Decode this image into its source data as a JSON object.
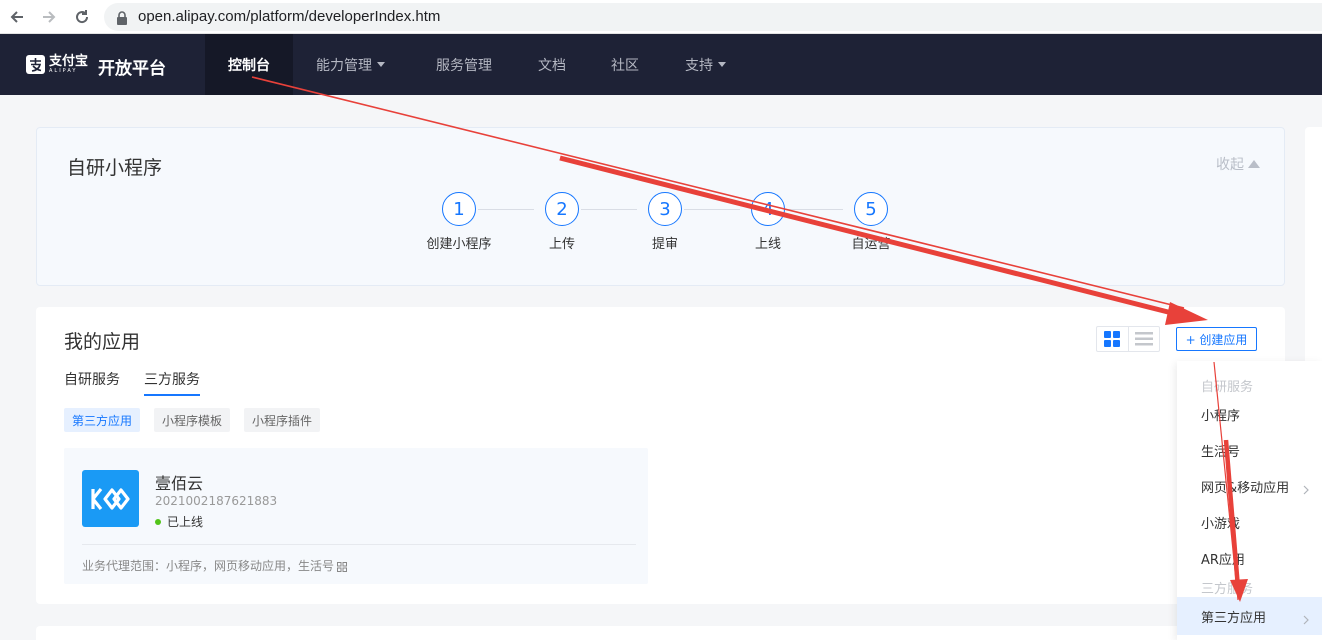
{
  "browser": {
    "url": "open.alipay.com/platform/developerIndex.htm"
  },
  "brand": {
    "logo_cn": "支付宝",
    "logo_en": "ALIPAY",
    "platform": "开放平台"
  },
  "topnav": {
    "items": [
      {
        "label": "控制台",
        "active": true
      },
      {
        "label": "能力管理",
        "caret": true
      },
      {
        "label": "服务管理"
      },
      {
        "label": "文档"
      },
      {
        "label": "社区"
      },
      {
        "label": "支持",
        "caret": true
      }
    ]
  },
  "miniprogram": {
    "title": "自研小程序",
    "collapse_label": "收起",
    "steps": [
      {
        "num": "1",
        "label": "创建小程序"
      },
      {
        "num": "2",
        "label": "上传"
      },
      {
        "num": "3",
        "label": "提审"
      },
      {
        "num": "4",
        "label": "上线"
      },
      {
        "num": "5",
        "label": "自运营"
      }
    ]
  },
  "apps": {
    "title": "我的应用",
    "create_label": "+ 创建应用",
    "tabs": [
      {
        "label": "自研服务"
      },
      {
        "label": "三方服务",
        "active": true
      }
    ],
    "chips": [
      {
        "label": "第三方应用",
        "active": true
      },
      {
        "label": "小程序模板"
      },
      {
        "label": "小程序插件"
      }
    ],
    "app": {
      "name": "壹佰云",
      "id": "2021002187621883",
      "status": "已上线",
      "scope": "业务代理范围：小程序，网页移动应用，生活号"
    }
  },
  "dropdown": {
    "group_self": "自研服务",
    "items_self": [
      "小程序",
      "生活号",
      "网页&移动应用",
      "小游戏",
      "AR应用"
    ],
    "group_third": "三方服务",
    "item_third": "第三方应用"
  },
  "colors": {
    "nav_bg": "#1e2236",
    "accent": "#1677ff",
    "annotation": "#e8413a"
  }
}
